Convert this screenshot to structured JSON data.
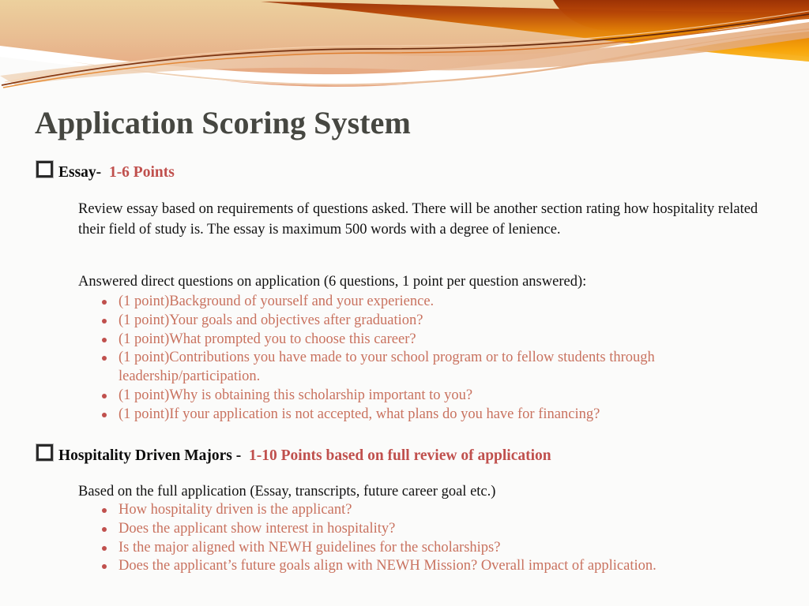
{
  "theme": {
    "background": "#fbfbfa",
    "title_color": "#464741",
    "accent_red": "#c0504d",
    "list_red": "#c9725f",
    "body_black": "#111111",
    "banner_tan_top": "#ebcb96",
    "banner_tan_bottom": "#e8a882",
    "banner_orange_top": "#a33708",
    "banner_orange_bottom": "#f59a08",
    "banner_peach": "#e8bb9b"
  },
  "slide": {
    "title": "Application Scoring System",
    "sections": [
      {
        "id": "essay",
        "glyph": "checkbox-square-icon",
        "label": "Essay-",
        "points": "1-6 Points",
        "paragraphs": [
          "Review essay based on requirements of questions asked. There will be another section rating how hospitality related their field of study is. The essay is maximum 500 words with a degree of lenience.",
          "Answered direct questions on application (6 questions, 1 point per question answered):"
        ],
        "items": [
          {
            "points": "(1 point)",
            "text": "Background of yourself and your experience."
          },
          {
            "points": "(1 point)",
            "text": "Your goals and objectives after graduation?"
          },
          {
            "points": "(1 point)",
            "text": "What prompted you to choose this career?"
          },
          {
            "points": "(1 point)",
            "text": "Contributions you have made to your school program or to fellow students through leadership/participation."
          },
          {
            "points": "(1 point)",
            "text": "Why is obtaining this scholarship important to you?"
          },
          {
            "points": "(1 point)",
            "text": "If your application is not accepted, what plans do you have for financing?"
          }
        ]
      },
      {
        "id": "majors",
        "glyph": "checkbox-square-icon",
        "label": "Hospitality Driven Majors -",
        "points": "1-10 Points based on full review of application",
        "paragraphs": [
          "Based on the full application (Essay, transcripts, future career goal etc.)"
        ],
        "items": [
          {
            "points": "",
            "text": "How hospitality driven is the applicant?"
          },
          {
            "points": "",
            "text": "Does the applicant show interest in hospitality?"
          },
          {
            "points": "",
            "text": "Is the major aligned with NEWH guidelines for the scholarships?"
          },
          {
            "points": "",
            "text": "Does the applicant’s future goals align with NEWH Mission? Overall impact of application."
          }
        ]
      }
    ]
  }
}
